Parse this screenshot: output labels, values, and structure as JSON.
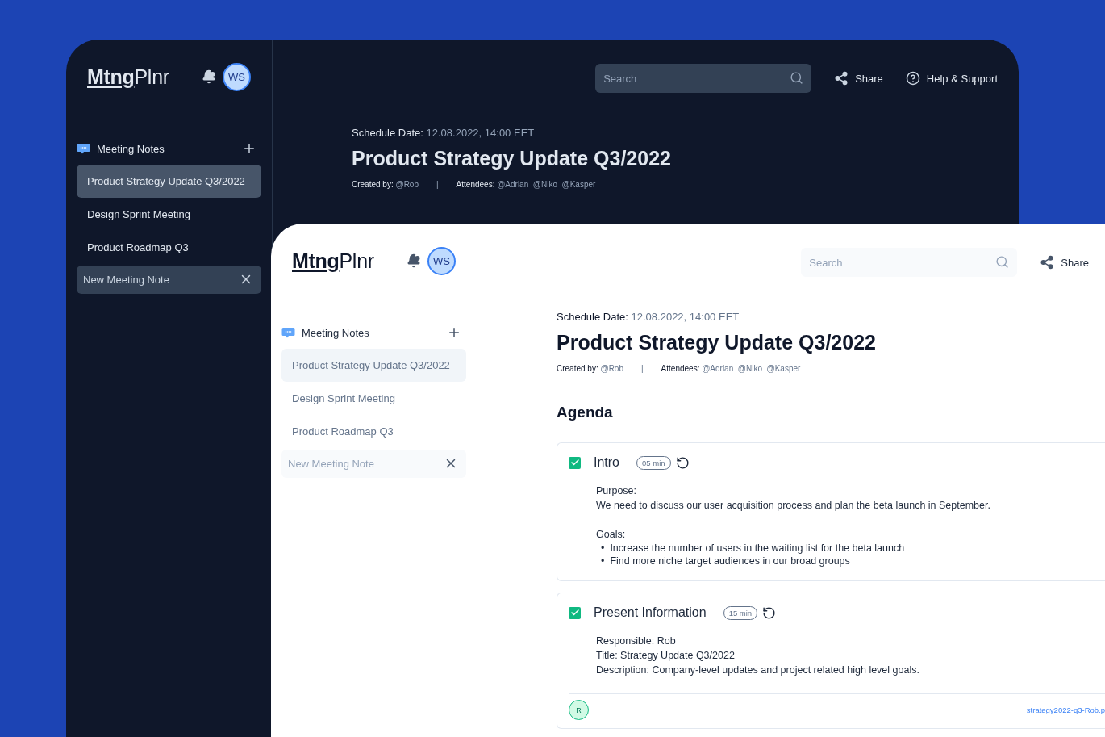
{
  "windows": [
    {
      "dark": true,
      "logo": "**Mtng**Plnr",
      "avatar": "WS",
      "sidebar": {
        "title": "Meeting Notes",
        "items": [
          {
            "label": "Product Strategy Update Q3/2022",
            "selected": true
          },
          {
            "label": "Design Sprint Meeting",
            "selected": false
          },
          {
            "label": "Product Roadmap Q3",
            "selected": false
          }
        ],
        "new_note": {
          "placeholder": "New Meeting Note"
        }
      },
      "toolbar": {
        "search": {
          "placeholder": "Search"
        },
        "share": "Share",
        "help": "Help & Support"
      },
      "note": {
        "schedule_label": "Schedule Date:",
        "schedule_value": "12.08.2022, 14:00 EET",
        "title": "Product Strategy Update Q3/2022",
        "created_label": "Created by:",
        "created_value": "@Rob",
        "separator": "|",
        "attendees_label": "Attendees:",
        "attendees_value": "@Adrian  @Niko  @Kasper"
      }
    },
    {
      "dark": false,
      "logo": "**Mtng**Plnr",
      "avatar": "WS",
      "sidebar": {
        "title": "Meeting Notes",
        "items": [
          {
            "label": "Product Strategy Update Q3/2022",
            "selected": true
          },
          {
            "label": "Design Sprint Meeting",
            "selected": false
          },
          {
            "label": "Product Roadmap Q3",
            "selected": false
          }
        ],
        "new_note": {
          "placeholder": "New Meeting Note"
        }
      },
      "toolbar": {
        "search": {
          "placeholder": "Search"
        },
        "share": "Share"
      },
      "note": {
        "schedule_label": "Schedule Date:",
        "schedule_value": "12.08.2022, 14:00 EET",
        "title": "Product Strategy Update Q3/2022",
        "created_label": "Created by:",
        "created_value": "@Rob",
        "separator": "|",
        "attendees_label": "Attendees:",
        "attendees_value": "@Adrian  @Niko  @Kasper"
      },
      "agenda": {
        "title": "Agenda",
        "items": [
          {
            "checked": true,
            "title": "Intro",
            "duration": "05 min",
            "blocks": [
              {
                "kind": "label",
                "text": "Purpose:"
              },
              {
                "kind": "text",
                "text": "We need to discuss our user acquisition process and plan the beta launch in September."
              },
              {
                "kind": "label",
                "text": "Goals:"
              },
              {
                "kind": "bullets",
                "marker": "•",
                "items": [
                  "Increase the number of users in the waiting list for the beta launch",
                  "Find more niche target audiences in our broad groups"
                ]
              }
            ]
          },
          {
            "checked": true,
            "title": "Present Information",
            "duration": "15 min",
            "blocks": [
              {
                "kind": "text",
                "text": "Responsible: Rob"
              },
              {
                "kind": "text",
                "text": "Title: Strategy Update Q3/2022"
              },
              {
                "kind": "text",
                "text": "Description: Company-level updates and project related high level goals."
              }
            ],
            "footer": {
              "avatar": "R",
              "attachment": "strategy2022-q3-Rob.p"
            }
          }
        ]
      }
    }
  ]
}
